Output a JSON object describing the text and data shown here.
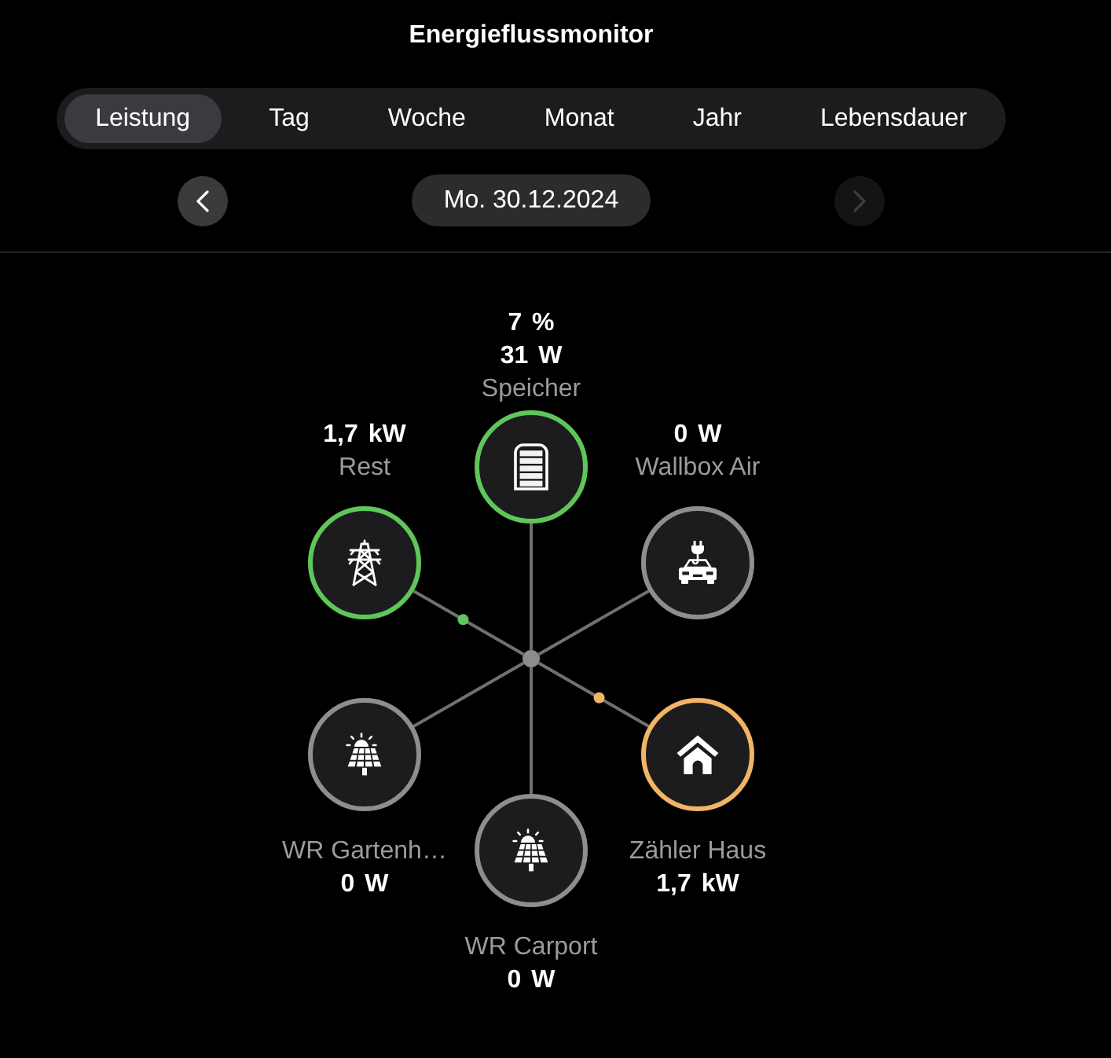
{
  "title": "Energieflussmonitor",
  "tabs": [
    {
      "label": "Leistung",
      "selected": true
    },
    {
      "label": "Tag",
      "selected": false
    },
    {
      "label": "Woche",
      "selected": false
    },
    {
      "label": "Monat",
      "selected": false
    },
    {
      "label": "Jahr",
      "selected": false
    },
    {
      "label": "Lebensdauer",
      "selected": false
    }
  ],
  "date_nav": {
    "previous": {
      "disabled": false
    },
    "date": "Mo. 30.12.2024",
    "next": {
      "disabled": true
    }
  },
  "flow": {
    "nodes": [
      {
        "name": "Speicher",
        "values": [
          "7 %",
          "31 W"
        ],
        "kind": "battery",
        "color": "#5fc65a",
        "flow_dot": false
      },
      {
        "name": "Rest",
        "values": [
          "1,7 kW"
        ],
        "kind": "grid",
        "color": "#5fc65a",
        "flow_dot": true
      },
      {
        "name": "Wallbox Air",
        "values": [
          "0 W"
        ],
        "kind": "charger",
        "color": "#8e8e8e",
        "flow_dot": false
      },
      {
        "name": "WR Gartenh…",
        "values": [
          "0 W"
        ],
        "kind": "inverter",
        "color": "#8e8e8e",
        "flow_dot": false
      },
      {
        "name": "Zähler Haus",
        "values": [
          "1,7 kW"
        ],
        "kind": "meter",
        "color": "#f2b465",
        "flow_dot": true
      },
      {
        "name": "WR Carport",
        "values": [
          "0 W"
        ],
        "kind": "inverter",
        "color": "#8e8e8e",
        "flow_dot": false
      }
    ]
  }
}
